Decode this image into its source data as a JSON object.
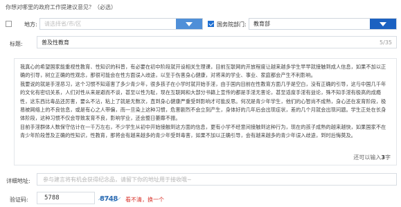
{
  "prompt": "你想对哪里的政府工作提建议意见？（必选）",
  "region": {
    "label": "地方:",
    "checked": false,
    "placeholder": "请选择省/市/区"
  },
  "department": {
    "label": "国务院部门:",
    "checked": true,
    "value": "教育部"
  },
  "title": {
    "label": "标题:",
    "value": "普及性教育",
    "counter": "5/35"
  },
  "content": {
    "paragraphs": [
      "我真心的希望国家能重视性教育、性知识的科普，有必要在初中阶段就开设相关生理课，目前互联网的开放程度让越来越多学生早早就接触到成人信息，如果不加以正确的引导，树立正确的性观念，那很可能会在性方面误入歧途，以至于伤害身心健康，对将来的学业、事业、家庭都会产生不利影响。",
      "我要说的就是手淫恶习，这个习惯不知道害了多少青少年，很多孩子在小学时就开始手淫，由于国内目前在性教育方面几乎是空白，没有正确的引导，这与中国几千年的文化有密切关系，人们对性从来是避而不谈，甚至以性为耻，现在互联网和大部分书籍上宣传的都是手淫无害论，甚至适度手淫有益论，殊不知手淫有极高的成瘾性，这东西比毒品还厉害，要么不沾，粘上了就是无数次，直到身心健康严重受到影响才可能反思。何况是青少年学生，他们的心智尚不成熟，身心还在发育阶段，极易被网络上的不良信息，或是有心之人带偏，而一旦染上这种习惯，危害剧烈不会立刻产生，身体好的几年后会出现症状，差的几个月就会出现问题。学生正处在长身体阶段，这种习惯不仅会导致发育不良，影响学业，还会整日萎靡不振。",
      "目前手淫群体人数保守估计在一千万左右，不少学生从初中开始接触到这方面的信息，更有小学不经意间接触到这种行为，现在的孩子成熟的越来越快，如果国家不在青少年阶段普及正确的性知识，性教育，那将会有越来越多的青少年受到毒害，如果不加以正确引导，会有越来越多的青少年误入歧途，到时后悔莫及。"
    ],
    "remaining_prefix": "还可以输入",
    "remaining_count": "3",
    "remaining_suffix": "字"
  },
  "address": {
    "label": "详细地址:",
    "placeholder": "参与建言将有机会获得纪念品，请留下你的地址用于接收哦~"
  },
  "captcha": {
    "label": "验证码:",
    "value": "5788",
    "image_text": "8748",
    "refresh_text": "看不清，换一个"
  },
  "colors": {
    "select_button": "#4f8fd8",
    "select_button_active": "#1b61c1",
    "checkbox_checked": "#1f6fd1",
    "refresh_link": "#d9332b"
  },
  "icons": {
    "dropdown": "triangle-down-icon",
    "checkbox_checked": "checkmark-icon"
  }
}
